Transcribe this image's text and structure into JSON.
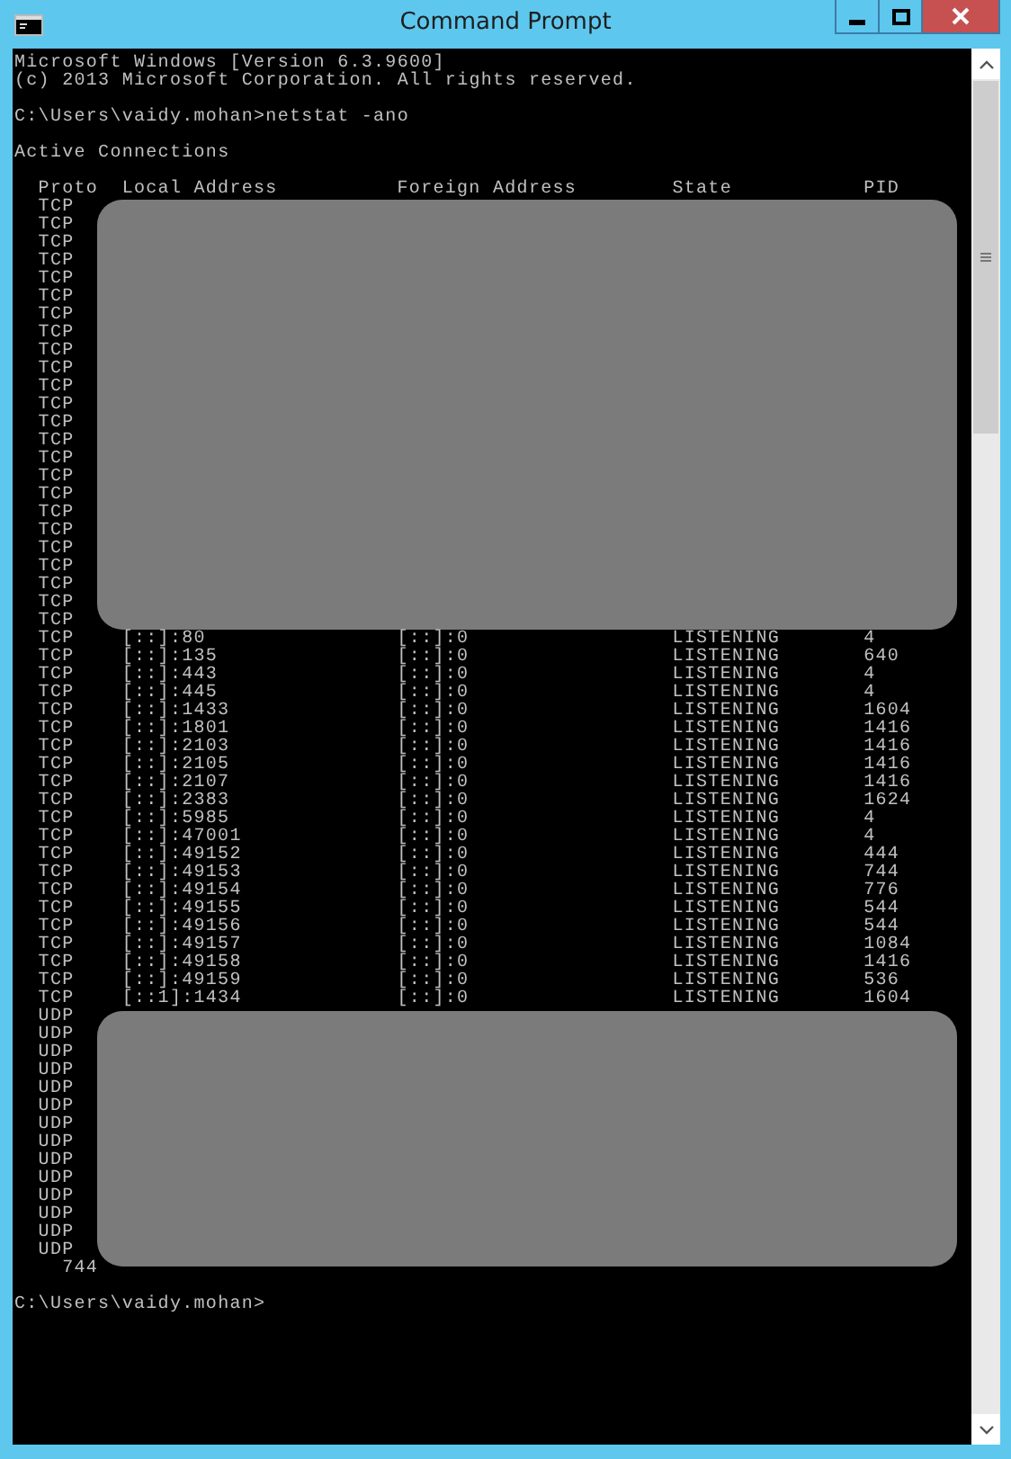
{
  "window": {
    "title": "Command Prompt"
  },
  "console": {
    "banner": [
      "Microsoft Windows [Version 6.3.9600]",
      "(c) 2013 Microsoft Corporation. All rights reserved."
    ],
    "prompt": "C:\\Users\\vaidy.mohan>",
    "command": "netstat -ano",
    "section_title": "Active Connections",
    "columns": [
      "Proto",
      "Local Address",
      "Foreign Address",
      "State",
      "PID"
    ],
    "rows": [
      {
        "proto": "TCP",
        "redacted": true
      },
      {
        "proto": "TCP",
        "redacted": true
      },
      {
        "proto": "TCP",
        "redacted": true
      },
      {
        "proto": "TCP",
        "redacted": true
      },
      {
        "proto": "TCP",
        "redacted": true
      },
      {
        "proto": "TCP",
        "redacted": true
      },
      {
        "proto": "TCP",
        "redacted": true
      },
      {
        "proto": "TCP",
        "redacted": true
      },
      {
        "proto": "TCP",
        "redacted": true
      },
      {
        "proto": "TCP",
        "redacted": true
      },
      {
        "proto": "TCP",
        "redacted": true
      },
      {
        "proto": "TCP",
        "redacted": true
      },
      {
        "proto": "TCP",
        "redacted": true
      },
      {
        "proto": "TCP",
        "redacted": true
      },
      {
        "proto": "TCP",
        "redacted": true
      },
      {
        "proto": "TCP",
        "redacted": true
      },
      {
        "proto": "TCP",
        "redacted": true
      },
      {
        "proto": "TCP",
        "redacted": true
      },
      {
        "proto": "TCP",
        "redacted": true
      },
      {
        "proto": "TCP",
        "redacted": true
      },
      {
        "proto": "TCP",
        "redacted": true
      },
      {
        "proto": "TCP",
        "redacted": true
      },
      {
        "proto": "TCP",
        "redacted": true
      },
      {
        "proto": "TCP",
        "redacted": true
      },
      {
        "proto": "TCP",
        "redacted": false,
        "local": "[::]:80",
        "foreign": "[::]:0",
        "state": "LISTENING",
        "pid": "4"
      },
      {
        "proto": "TCP",
        "redacted": false,
        "local": "[::]:135",
        "foreign": "[::]:0",
        "state": "LISTENING",
        "pid": "640"
      },
      {
        "proto": "TCP",
        "redacted": false,
        "local": "[::]:443",
        "foreign": "[::]:0",
        "state": "LISTENING",
        "pid": "4"
      },
      {
        "proto": "TCP",
        "redacted": false,
        "local": "[::]:445",
        "foreign": "[::]:0",
        "state": "LISTENING",
        "pid": "4"
      },
      {
        "proto": "TCP",
        "redacted": false,
        "local": "[::]:1433",
        "foreign": "[::]:0",
        "state": "LISTENING",
        "pid": "1604"
      },
      {
        "proto": "TCP",
        "redacted": false,
        "local": "[::]:1801",
        "foreign": "[::]:0",
        "state": "LISTENING",
        "pid": "1416"
      },
      {
        "proto": "TCP",
        "redacted": false,
        "local": "[::]:2103",
        "foreign": "[::]:0",
        "state": "LISTENING",
        "pid": "1416"
      },
      {
        "proto": "TCP",
        "redacted": false,
        "local": "[::]:2105",
        "foreign": "[::]:0",
        "state": "LISTENING",
        "pid": "1416"
      },
      {
        "proto": "TCP",
        "redacted": false,
        "local": "[::]:2107",
        "foreign": "[::]:0",
        "state": "LISTENING",
        "pid": "1416"
      },
      {
        "proto": "TCP",
        "redacted": false,
        "local": "[::]:2383",
        "foreign": "[::]:0",
        "state": "LISTENING",
        "pid": "1624"
      },
      {
        "proto": "TCP",
        "redacted": false,
        "local": "[::]:5985",
        "foreign": "[::]:0",
        "state": "LISTENING",
        "pid": "4"
      },
      {
        "proto": "TCP",
        "redacted": false,
        "local": "[::]:47001",
        "foreign": "[::]:0",
        "state": "LISTENING",
        "pid": "4"
      },
      {
        "proto": "TCP",
        "redacted": false,
        "local": "[::]:49152",
        "foreign": "[::]:0",
        "state": "LISTENING",
        "pid": "444"
      },
      {
        "proto": "TCP",
        "redacted": false,
        "local": "[::]:49153",
        "foreign": "[::]:0",
        "state": "LISTENING",
        "pid": "744"
      },
      {
        "proto": "TCP",
        "redacted": false,
        "local": "[::]:49154",
        "foreign": "[::]:0",
        "state": "LISTENING",
        "pid": "776"
      },
      {
        "proto": "TCP",
        "redacted": false,
        "local": "[::]:49155",
        "foreign": "[::]:0",
        "state": "LISTENING",
        "pid": "544"
      },
      {
        "proto": "TCP",
        "redacted": false,
        "local": "[::]:49156",
        "foreign": "[::]:0",
        "state": "LISTENING",
        "pid": "544"
      },
      {
        "proto": "TCP",
        "redacted": false,
        "local": "[::]:49157",
        "foreign": "[::]:0",
        "state": "LISTENING",
        "pid": "1084"
      },
      {
        "proto": "TCP",
        "redacted": false,
        "local": "[::]:49158",
        "foreign": "[::]:0",
        "state": "LISTENING",
        "pid": "1416"
      },
      {
        "proto": "TCP",
        "redacted": false,
        "local": "[::]:49159",
        "foreign": "[::]:0",
        "state": "LISTENING",
        "pid": "536"
      },
      {
        "proto": "TCP",
        "redacted": false,
        "local": "[::1]:1434",
        "foreign": "[::]:0",
        "state": "LISTENING",
        "pid": "1604"
      },
      {
        "proto": "UDP",
        "redacted": true
      },
      {
        "proto": "UDP",
        "redacted": true
      },
      {
        "proto": "UDP",
        "redacted": true
      },
      {
        "proto": "UDP",
        "redacted": true
      },
      {
        "proto": "UDP",
        "redacted": true
      },
      {
        "proto": "UDP",
        "redacted": true
      },
      {
        "proto": "UDP",
        "redacted": true
      },
      {
        "proto": "UDP",
        "redacted": true
      },
      {
        "proto": "UDP",
        "redacted": true
      },
      {
        "proto": "UDP",
        "redacted": true
      },
      {
        "proto": "UDP",
        "redacted": true
      },
      {
        "proto": "UDP",
        "redacted": true
      },
      {
        "proto": "UDP",
        "redacted": true
      },
      {
        "proto": "UDP",
        "redacted": true
      }
    ],
    "wrapped_tail": "744",
    "final_prompt": "C:\\Users\\vaidy.mohan>"
  }
}
